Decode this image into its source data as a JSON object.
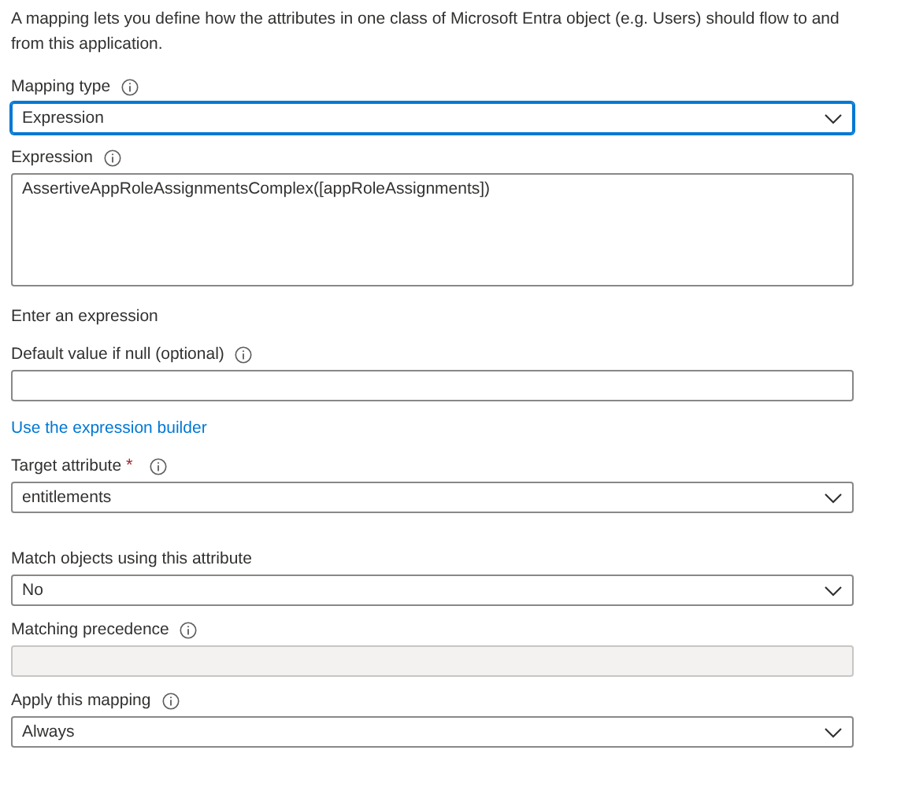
{
  "intro": "A mapping lets you define how the attributes in one class of Microsoft Entra object (e.g. Users) should flow to and from this application.",
  "fields": [
    {
      "kind": "dropdown",
      "label": "Mapping type",
      "info": true,
      "value": "Expression",
      "focused": true
    },
    {
      "kind": "textarea",
      "label": "Expression",
      "info": true,
      "value": "AssertiveAppRoleAssignmentsComplex([appRoleAssignments])"
    },
    {
      "kind": "note",
      "label": "Enter an expression"
    },
    {
      "kind": "text",
      "label": "Default value if null (optional)",
      "info": true
    },
    {
      "kind": "link",
      "label": "Use the expression builder"
    },
    {
      "kind": "dropdown",
      "label": "Target attribute",
      "required_mark": "*",
      "info": true,
      "value": "entitlements",
      "focused": false
    },
    {
      "kind": "dropdown",
      "label": "Match objects using this attribute",
      "info": false,
      "value": "No",
      "focused": false
    },
    {
      "kind": "text",
      "label": "Matching precedence",
      "info": true,
      "disabled": true
    },
    {
      "kind": "dropdown",
      "label": "Apply this mapping",
      "info": true,
      "value": "Always",
      "focused": false
    }
  ]
}
